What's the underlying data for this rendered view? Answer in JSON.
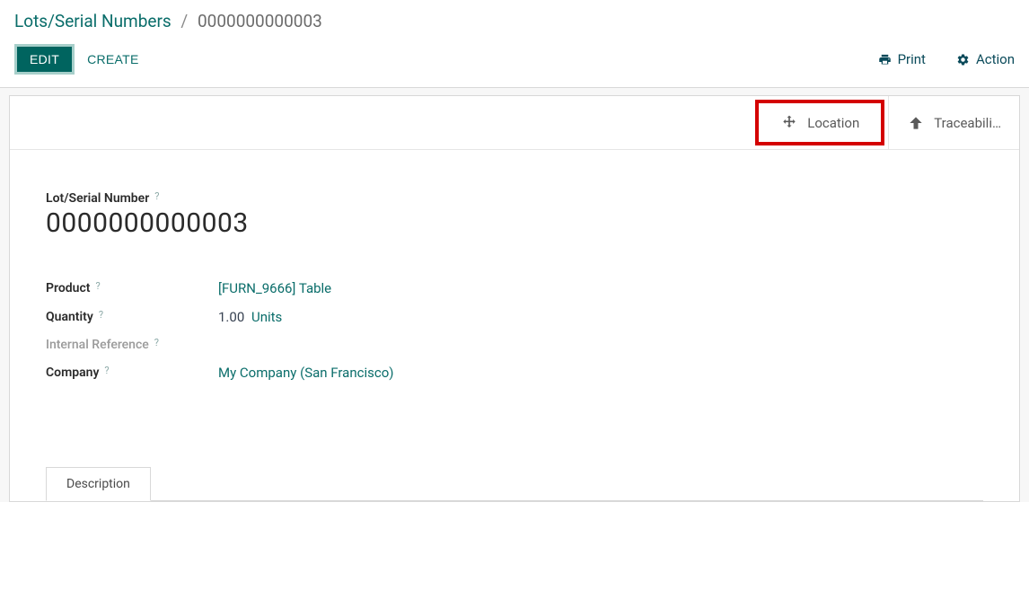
{
  "breadcrumb": {
    "parent": "Lots/Serial Numbers",
    "current": "0000000000003"
  },
  "toolbar": {
    "edit": "EDIT",
    "create": "CREATE",
    "print": "Print",
    "action": "Action"
  },
  "button_box": {
    "location": "Location",
    "traceability": "Traceabili…"
  },
  "title": {
    "label": "Lot/Serial Number",
    "value": "0000000000003"
  },
  "fields": {
    "product": {
      "label": "Product",
      "value": "[FURN_9666] Table"
    },
    "quantity": {
      "label": "Quantity",
      "value": "1.00",
      "uom": "Units"
    },
    "internal_ref": {
      "label": "Internal Reference",
      "value": ""
    },
    "company": {
      "label": "Company",
      "value": "My Company (San Francisco)"
    }
  },
  "tabs": {
    "description": "Description"
  }
}
